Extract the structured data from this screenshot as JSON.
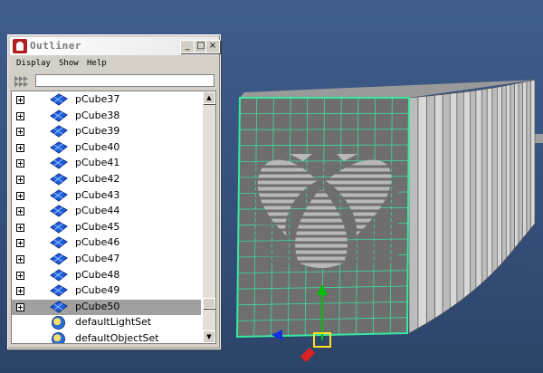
{
  "outliner": {
    "title": "Outliner",
    "window_buttons": {
      "minimize": "_",
      "maximize": "□",
      "close": "×"
    },
    "menu": [
      "Display",
      "Show",
      "Help"
    ],
    "search": {
      "value": "",
      "placeholder": ""
    },
    "items": [
      {
        "label": "pCube37",
        "type": "mesh",
        "expandable": true,
        "selected": false
      },
      {
        "label": "pCube38",
        "type": "mesh",
        "expandable": true,
        "selected": false
      },
      {
        "label": "pCube39",
        "type": "mesh",
        "expandable": true,
        "selected": false
      },
      {
        "label": "pCube40",
        "type": "mesh",
        "expandable": true,
        "selected": false
      },
      {
        "label": "pCube41",
        "type": "mesh",
        "expandable": true,
        "selected": false
      },
      {
        "label": "pCube42",
        "type": "mesh",
        "expandable": true,
        "selected": false
      },
      {
        "label": "pCube43",
        "type": "mesh",
        "expandable": true,
        "selected": false
      },
      {
        "label": "pCube44",
        "type": "mesh",
        "expandable": true,
        "selected": false
      },
      {
        "label": "pCube45",
        "type": "mesh",
        "expandable": true,
        "selected": false
      },
      {
        "label": "pCube46",
        "type": "mesh",
        "expandable": true,
        "selected": false
      },
      {
        "label": "pCube47",
        "type": "mesh",
        "expandable": true,
        "selected": false
      },
      {
        "label": "pCube48",
        "type": "mesh",
        "expandable": true,
        "selected": false
      },
      {
        "label": "pCube49",
        "type": "mesh",
        "expandable": true,
        "selected": false
      },
      {
        "label": "pCube50",
        "type": "mesh",
        "expandable": true,
        "selected": true
      },
      {
        "label": "defaultLightSet",
        "type": "set",
        "expandable": false,
        "selected": false
      },
      {
        "label": "defaultObjectSet",
        "type": "set",
        "expandable": false,
        "selected": false
      }
    ],
    "scroll_position": 0.9
  },
  "viewport": {
    "object_icons": {
      "item": "mesh-cube-icon",
      "set": "object-set-icon"
    },
    "colors": {
      "selection_wireframe": "#40e0a0",
      "background": "#3a5580",
      "card_face": "#7a7a7a",
      "manipulator_y": "#00c000",
      "manipulator_z": "#e02020",
      "manipulator_x": "#1030e0",
      "pivot": "#ffe020"
    }
  }
}
